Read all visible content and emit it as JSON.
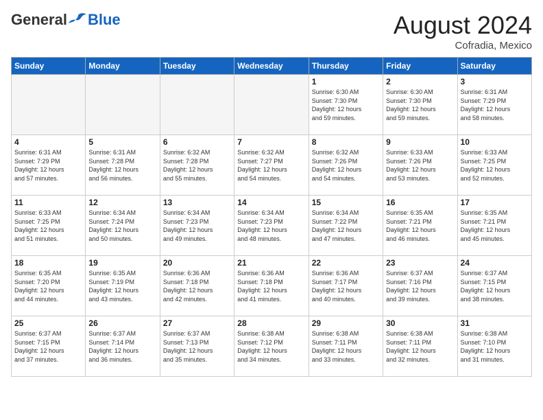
{
  "logo": {
    "general": "General",
    "blue": "Blue"
  },
  "title": "August 2024",
  "location": "Cofradia, Mexico",
  "days_of_week": [
    "Sunday",
    "Monday",
    "Tuesday",
    "Wednesday",
    "Thursday",
    "Friday",
    "Saturday"
  ],
  "weeks": [
    [
      {
        "day": "",
        "info": ""
      },
      {
        "day": "",
        "info": ""
      },
      {
        "day": "",
        "info": ""
      },
      {
        "day": "",
        "info": ""
      },
      {
        "day": "1",
        "info": "Sunrise: 6:30 AM\nSunset: 7:30 PM\nDaylight: 12 hours\nand 59 minutes."
      },
      {
        "day": "2",
        "info": "Sunrise: 6:30 AM\nSunset: 7:30 PM\nDaylight: 12 hours\nand 59 minutes."
      },
      {
        "day": "3",
        "info": "Sunrise: 6:31 AM\nSunset: 7:29 PM\nDaylight: 12 hours\nand 58 minutes."
      }
    ],
    [
      {
        "day": "4",
        "info": "Sunrise: 6:31 AM\nSunset: 7:29 PM\nDaylight: 12 hours\nand 57 minutes."
      },
      {
        "day": "5",
        "info": "Sunrise: 6:31 AM\nSunset: 7:28 PM\nDaylight: 12 hours\nand 56 minutes."
      },
      {
        "day": "6",
        "info": "Sunrise: 6:32 AM\nSunset: 7:28 PM\nDaylight: 12 hours\nand 55 minutes."
      },
      {
        "day": "7",
        "info": "Sunrise: 6:32 AM\nSunset: 7:27 PM\nDaylight: 12 hours\nand 54 minutes."
      },
      {
        "day": "8",
        "info": "Sunrise: 6:32 AM\nSunset: 7:26 PM\nDaylight: 12 hours\nand 54 minutes."
      },
      {
        "day": "9",
        "info": "Sunrise: 6:33 AM\nSunset: 7:26 PM\nDaylight: 12 hours\nand 53 minutes."
      },
      {
        "day": "10",
        "info": "Sunrise: 6:33 AM\nSunset: 7:25 PM\nDaylight: 12 hours\nand 52 minutes."
      }
    ],
    [
      {
        "day": "11",
        "info": "Sunrise: 6:33 AM\nSunset: 7:25 PM\nDaylight: 12 hours\nand 51 minutes."
      },
      {
        "day": "12",
        "info": "Sunrise: 6:34 AM\nSunset: 7:24 PM\nDaylight: 12 hours\nand 50 minutes."
      },
      {
        "day": "13",
        "info": "Sunrise: 6:34 AM\nSunset: 7:23 PM\nDaylight: 12 hours\nand 49 minutes."
      },
      {
        "day": "14",
        "info": "Sunrise: 6:34 AM\nSunset: 7:23 PM\nDaylight: 12 hours\nand 48 minutes."
      },
      {
        "day": "15",
        "info": "Sunrise: 6:34 AM\nSunset: 7:22 PM\nDaylight: 12 hours\nand 47 minutes."
      },
      {
        "day": "16",
        "info": "Sunrise: 6:35 AM\nSunset: 7:21 PM\nDaylight: 12 hours\nand 46 minutes."
      },
      {
        "day": "17",
        "info": "Sunrise: 6:35 AM\nSunset: 7:21 PM\nDaylight: 12 hours\nand 45 minutes."
      }
    ],
    [
      {
        "day": "18",
        "info": "Sunrise: 6:35 AM\nSunset: 7:20 PM\nDaylight: 12 hours\nand 44 minutes."
      },
      {
        "day": "19",
        "info": "Sunrise: 6:35 AM\nSunset: 7:19 PM\nDaylight: 12 hours\nand 43 minutes."
      },
      {
        "day": "20",
        "info": "Sunrise: 6:36 AM\nSunset: 7:18 PM\nDaylight: 12 hours\nand 42 minutes."
      },
      {
        "day": "21",
        "info": "Sunrise: 6:36 AM\nSunset: 7:18 PM\nDaylight: 12 hours\nand 41 minutes."
      },
      {
        "day": "22",
        "info": "Sunrise: 6:36 AM\nSunset: 7:17 PM\nDaylight: 12 hours\nand 40 minutes."
      },
      {
        "day": "23",
        "info": "Sunrise: 6:37 AM\nSunset: 7:16 PM\nDaylight: 12 hours\nand 39 minutes."
      },
      {
        "day": "24",
        "info": "Sunrise: 6:37 AM\nSunset: 7:15 PM\nDaylight: 12 hours\nand 38 minutes."
      }
    ],
    [
      {
        "day": "25",
        "info": "Sunrise: 6:37 AM\nSunset: 7:15 PM\nDaylight: 12 hours\nand 37 minutes."
      },
      {
        "day": "26",
        "info": "Sunrise: 6:37 AM\nSunset: 7:14 PM\nDaylight: 12 hours\nand 36 minutes."
      },
      {
        "day": "27",
        "info": "Sunrise: 6:37 AM\nSunset: 7:13 PM\nDaylight: 12 hours\nand 35 minutes."
      },
      {
        "day": "28",
        "info": "Sunrise: 6:38 AM\nSunset: 7:12 PM\nDaylight: 12 hours\nand 34 minutes."
      },
      {
        "day": "29",
        "info": "Sunrise: 6:38 AM\nSunset: 7:11 PM\nDaylight: 12 hours\nand 33 minutes."
      },
      {
        "day": "30",
        "info": "Sunrise: 6:38 AM\nSunset: 7:11 PM\nDaylight: 12 hours\nand 32 minutes."
      },
      {
        "day": "31",
        "info": "Sunrise: 6:38 AM\nSunset: 7:10 PM\nDaylight: 12 hours\nand 31 minutes."
      }
    ]
  ]
}
